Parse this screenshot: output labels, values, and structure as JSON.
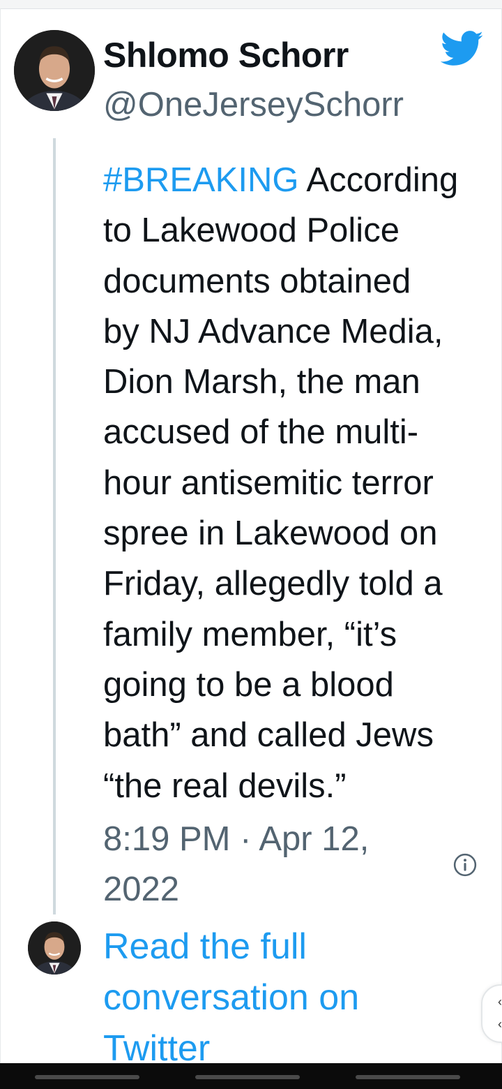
{
  "tweet": {
    "author_name": "Shlomo Schorr",
    "author_handle": "@OneJerseySchorr",
    "hashtag": "#BREAKING",
    "text_lines": [
      " According",
      "to Lakewood Police",
      "documents obtained",
      "by NJ Advance Media,",
      "Dion Marsh, the man",
      "accused of the multi-",
      "hour antisemitic terror",
      "spree in Lakewood on",
      "Friday, allegedly told a",
      "family member, “it’s",
      "going to be a blood",
      "bath” and called Jews",
      "“the real devils.”"
    ],
    "timestamp_line1": "8:19 PM · Apr 12,",
    "timestamp_line2": "2022"
  },
  "footer": {
    "read_more_line1": "Read the full",
    "read_more_line2": "conversation on",
    "read_more_line3": "Twitter"
  },
  "icons": {
    "brand": "twitter-bird-icon",
    "info": "info-icon"
  },
  "colors": {
    "link_blue": "#1d9bf0",
    "text_primary": "#0f1419",
    "text_secondary": "#536471",
    "thread_line": "#cfd9de"
  }
}
